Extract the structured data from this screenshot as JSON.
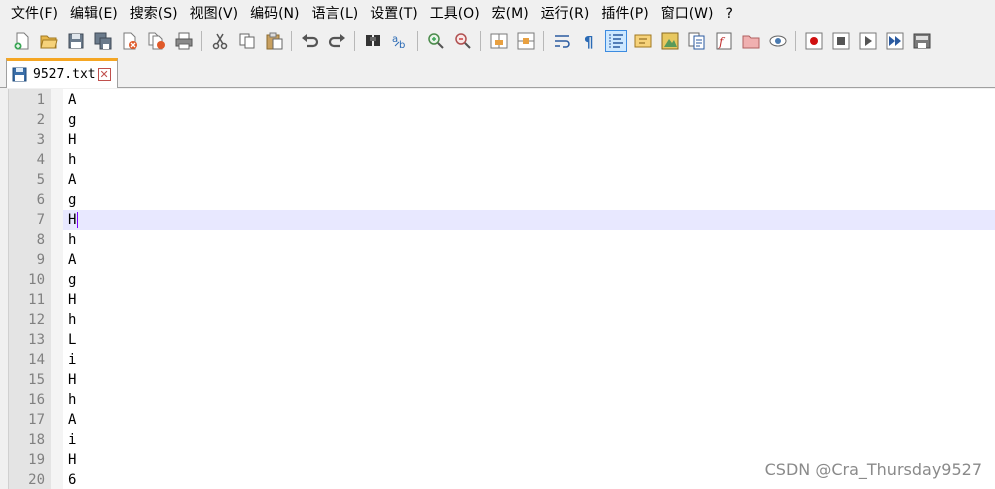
{
  "menu": [
    "文件(F)",
    "编辑(E)",
    "搜索(S)",
    "视图(V)",
    "编码(N)",
    "语言(L)",
    "设置(T)",
    "工具(O)",
    "宏(M)",
    "运行(R)",
    "插件(P)",
    "窗口(W)",
    "?"
  ],
  "tab": {
    "name": "9527.txt",
    "close_glyph": "✕"
  },
  "lines": [
    "A",
    "g",
    "H",
    "h",
    "A",
    "g",
    "H",
    "h",
    "A",
    "g",
    "H",
    "h",
    "L",
    "i",
    "H",
    "h",
    "A",
    "i",
    "H",
    "6"
  ],
  "line_numbers": [
    "1",
    "2",
    "3",
    "4",
    "5",
    "6",
    "7",
    "8",
    "9",
    "10",
    "11",
    "12",
    "13",
    "14",
    "15",
    "16",
    "17",
    "18",
    "19",
    "20"
  ],
  "current_line": 7,
  "watermark": "CSDN @Cra_Thursday9527",
  "colors": {
    "current_line_bg": "#e8e8ff",
    "caret": "#8000ff",
    "tab_accent": "#f5a623",
    "gutter_bg": "#e4e4e4"
  }
}
